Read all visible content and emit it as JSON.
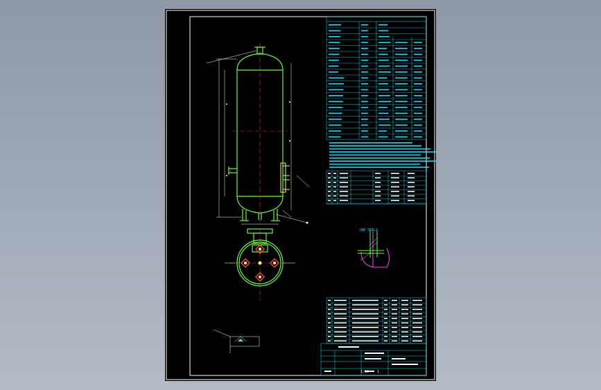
{
  "drawing": {
    "notes_heading": "",
    "detail_caption": "(NO SEAL)",
    "view_caption": "",
    "title_block": {
      "label_drawing": "",
      "label_sheet": "1",
      "scale": "1:10"
    }
  },
  "colors": {
    "background": "#000000",
    "frame": "#ffffff",
    "vessel": "#66ff33",
    "centerline": "#ff3333",
    "table": "#00e5ff",
    "annotation": "#ffffff",
    "nozzle": "#ffff44",
    "detail": "#ff44ff"
  }
}
